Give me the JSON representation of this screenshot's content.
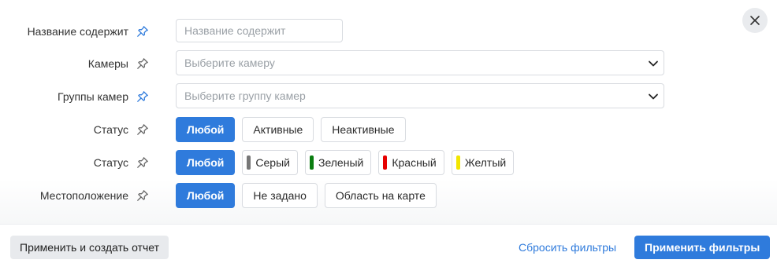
{
  "close": {
    "icon": "close-icon"
  },
  "filters": {
    "content_name": {
      "label": "Название содержит",
      "pinned": true,
      "placeholder": "Название содержит",
      "value": ""
    },
    "cameras": {
      "label": "Камеры",
      "pinned": false,
      "placeholder": "Выберите камеру"
    },
    "camera_groups": {
      "label": "Группы камер",
      "pinned": true,
      "placeholder": "Выберите группу камер"
    },
    "status_activity": {
      "label": "Статус",
      "pinned": false,
      "options": [
        "Любой",
        "Активные",
        "Неактивные"
      ],
      "selected": "Любой"
    },
    "status_color": {
      "label": "Статус",
      "pinned": false,
      "options": [
        {
          "label": "Любой"
        },
        {
          "label": "Серый",
          "color": "#777777"
        },
        {
          "label": "Зеленый",
          "color": "#0a7d10"
        },
        {
          "label": "Красный",
          "color": "#e60000"
        },
        {
          "label": "Желтый",
          "color": "#f2e600"
        }
      ],
      "selected": "Любой"
    },
    "location": {
      "label": "Местоположение",
      "pinned": false,
      "options": [
        "Любой",
        "Не задано",
        "Область на карте"
      ],
      "selected": "Любой"
    }
  },
  "footer": {
    "apply_and_report": "Применить и создать отчет",
    "reset": "Сбросить фильтры",
    "apply": "Применить фильтры"
  },
  "colors": {
    "accent": "#2f7bdc",
    "pin_active": "#2f7bdc",
    "pin_inactive": "#666666"
  }
}
